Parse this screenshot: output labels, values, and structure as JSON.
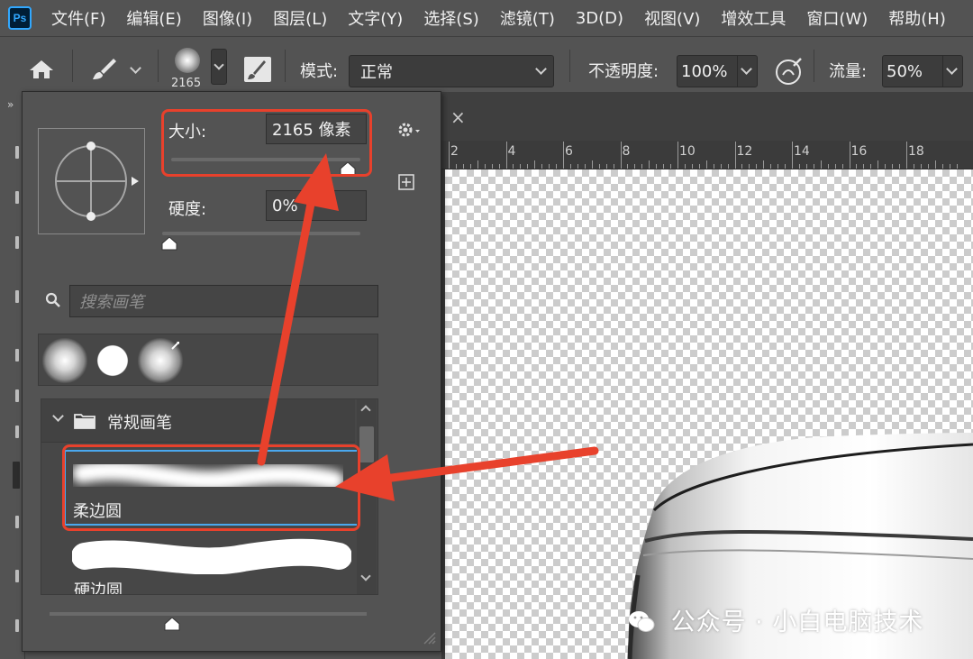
{
  "menubar": {
    "logo": "Ps",
    "items": [
      "文件(F)",
      "编辑(E)",
      "图像(I)",
      "图层(L)",
      "文字(Y)",
      "选择(S)",
      "滤镜(T)",
      "3D(D)",
      "视图(V)",
      "增效工具",
      "窗口(W)",
      "帮助(H)"
    ]
  },
  "options": {
    "brush_size_value": "2165",
    "mode_label": "模式:",
    "mode_value": "正常",
    "opacity_label": "不透明度:",
    "opacity_value": "100%",
    "flow_label": "流量:",
    "flow_value": "50%"
  },
  "document": {
    "ruler_labels": [
      "2",
      "4",
      "6",
      "8",
      "10",
      "12",
      "14",
      "16",
      "18"
    ]
  },
  "brush_panel": {
    "size_label": "大小:",
    "size_value": "2165 像素",
    "hardness_label": "硬度:",
    "hardness_value": "0%",
    "search_placeholder": "搜索画笔",
    "group_name": "常规画笔",
    "brushes": [
      {
        "name": "柔边圆"
      },
      {
        "name": "硬边圆"
      }
    ]
  },
  "watermark": {
    "text": "公众号 · 小白电脑技术"
  },
  "colors": {
    "accent_red": "#e8412c",
    "selection_blue": "#4aa8ee",
    "ps_blue": "#31a8ff"
  }
}
